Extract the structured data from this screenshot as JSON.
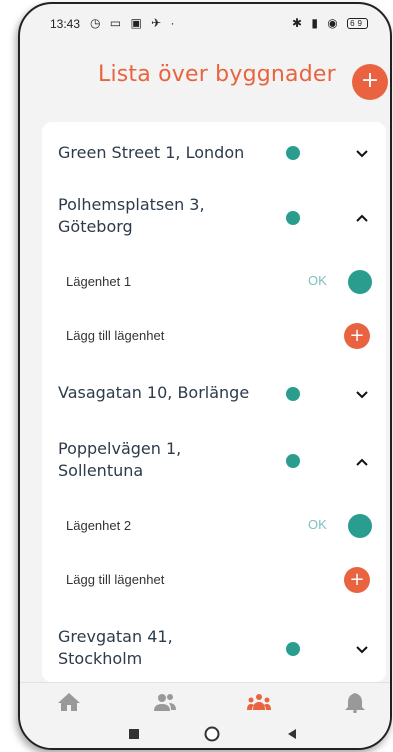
{
  "status_bar": {
    "time": "13:43",
    "left_icons": "◷ ▭ ▣ ✈ ·",
    "right_icons": "✱ ▮ ◉",
    "battery": "69"
  },
  "header": {
    "title": "Lista över byggnader",
    "add_label": "+"
  },
  "colors": {
    "accent": "#ea6340",
    "status_green": "#2a9d8f",
    "text_dark": "#2d3b4a",
    "tab_active": "#ea6340",
    "tab_inactive": "#999999"
  },
  "buildings": [
    {
      "name": "Green Street 1, London",
      "expanded": false
    },
    {
      "name": "Polhemsplatsen 3, Göteborg",
      "line1": "Polhemsplatsen 3,",
      "line2": "Göteborg",
      "expanded": true,
      "apartment": {
        "label": "Lägenhet 1",
        "status": "OK"
      },
      "add_label": "Lägg till lägenhet"
    },
    {
      "name": "Vasagatan 10, Borlänge",
      "expanded": false
    },
    {
      "name": "Poppelvägen 1, Sollentuna",
      "line1": "Poppelvägen 1,",
      "line2": "Sollentuna",
      "expanded": true,
      "apartment": {
        "label": "Lägenhet 2",
        "status": "OK"
      },
      "add_label": "Lägg till lägenhet"
    },
    {
      "name": "Grevgatan 41, Stockholm",
      "line1": "Grevgatan 41,",
      "line2": "Stockholm",
      "expanded": false
    }
  ],
  "add_apartment_icon": "+",
  "tabs": [
    {
      "icon": "home-icon",
      "active": false
    },
    {
      "icon": "users-icon",
      "active": false
    },
    {
      "icon": "group-icon",
      "active": true
    },
    {
      "icon": "bell-icon",
      "active": false
    }
  ],
  "nav": [
    "square-icon",
    "circle-icon",
    "back-triangle-icon"
  ]
}
